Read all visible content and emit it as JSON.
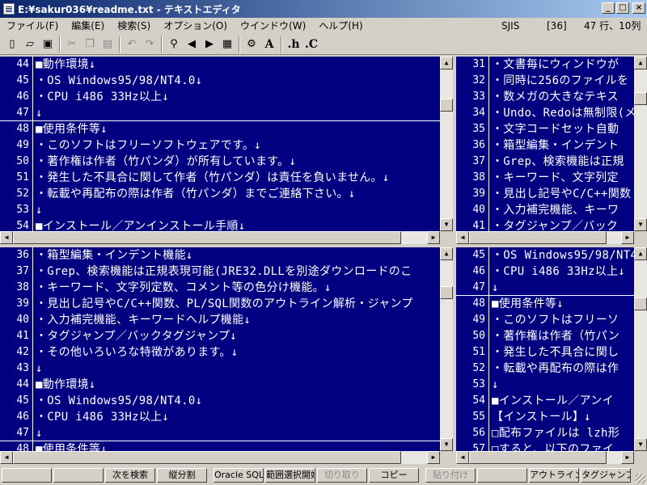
{
  "window": {
    "title": "E:¥sakur036¥readme.txt - テキストエディタ",
    "controls": [
      "_",
      "□",
      "×"
    ]
  },
  "menu": {
    "items": [
      "ファイル(F)",
      "編集(E)",
      "検索(S)",
      "オプション(O)",
      "ウインドウ(W)",
      "ヘルプ(H)"
    ],
    "encoding": "SJIS",
    "mode": "[36]",
    "position": "47 行、10列"
  },
  "toolbar": {
    "buttons": [
      {
        "icon": "new-file-icon",
        "glyph": "▯",
        "enabled": true
      },
      {
        "icon": "open-folder-icon",
        "glyph": "▱",
        "enabled": true
      },
      {
        "icon": "save-icon",
        "glyph": "▣",
        "enabled": true
      },
      {
        "icon": "cut-icon",
        "glyph": "✂",
        "enabled": false
      },
      {
        "icon": "copy-icon",
        "glyph": "❐",
        "enabled": false
      },
      {
        "icon": "paste-icon",
        "glyph": "▤",
        "enabled": false
      },
      {
        "icon": "undo-icon",
        "glyph": "↶",
        "enabled": false
      },
      {
        "icon": "redo-icon",
        "glyph": "↷",
        "enabled": false
      },
      {
        "icon": "search-icon",
        "glyph": "⚲",
        "enabled": true
      },
      {
        "icon": "find-prev-icon",
        "glyph": "◀",
        "enabled": true
      },
      {
        "icon": "find-next-icon",
        "glyph": "▶",
        "enabled": true
      },
      {
        "icon": "grep-icon",
        "glyph": "▦",
        "enabled": true
      },
      {
        "icon": "settings-icon",
        "glyph": "⚙",
        "enabled": true
      },
      {
        "icon": "font-icon",
        "glyph": "A",
        "enabled": true
      },
      {
        "icon": "h-file-icon",
        "glyph": ".h",
        "enabled": true
      },
      {
        "icon": "c-file-icon",
        "glyph": ".C",
        "enabled": true
      }
    ]
  },
  "panes": {
    "top_left": {
      "lines": [
        {
          "n": "44",
          "t": "■動作環境↓"
        },
        {
          "n": "45",
          "t": "・OS Windows95/98/NT4.0↓"
        },
        {
          "n": "46",
          "t": "・CPU i486 33Hz以上↓"
        },
        {
          "n": "47",
          "t": "↓"
        },
        {
          "n": "48",
          "t": "■使用条件等↓"
        },
        {
          "n": "49",
          "t": "・このソフトはフリーソフトウェアです。↓"
        },
        {
          "n": "50",
          "t": "・著作権は作者（竹パンダ）が所有しています。↓"
        },
        {
          "n": "51",
          "t": "・発生した不具合に関して作者（竹パンダ）は責任を負いません。↓"
        },
        {
          "n": "52",
          "t": "・転載や再配布の際は作者（竹パンダ）までご連絡下さい。↓"
        },
        {
          "n": "53",
          "t": "↓"
        },
        {
          "n": "54",
          "t": "■インストール／アンインストール手順↓"
        }
      ]
    },
    "top_right": {
      "lines": [
        {
          "n": "31",
          "t": "・文書毎にウィンドウが"
        },
        {
          "n": "32",
          "t": "・同時に256のファイルを"
        },
        {
          "n": "33",
          "t": "・数メガの大きなテキス"
        },
        {
          "n": "34",
          "t": "・Undo、Redoは無制限(メ"
        },
        {
          "n": "35",
          "t": "・文字コードセット自動"
        },
        {
          "n": "36",
          "t": "・箱型編集・インデント"
        },
        {
          "n": "37",
          "t": "・Grep、検索機能は正規"
        },
        {
          "n": "38",
          "t": "・キーワード、文字列定"
        },
        {
          "n": "39",
          "t": "・見出し記号やC/C++関数"
        },
        {
          "n": "40",
          "t": "・入力補完機能、キーワ"
        },
        {
          "n": "41",
          "t": "・タグジャンプ／バック"
        }
      ]
    },
    "bottom_left": {
      "lines": [
        {
          "n": "36",
          "t": "・箱型編集・インデント機能↓"
        },
        {
          "n": "37",
          "t": "・Grep、検索機能は正規表現可能(JRE32.DLLを別途ダウンロードのこ"
        },
        {
          "n": "38",
          "t": "・キーワード、文字列定数、コメント等の色分け機能。↓"
        },
        {
          "n": "39",
          "t": "・見出し記号やC/C++関数、PL/SQL関数のアウトライン解析・ジャンプ"
        },
        {
          "n": "40",
          "t": "・入力補完機能、キーワードヘルプ機能↓"
        },
        {
          "n": "41",
          "t": "・タグジャンプ／バックタグジャンプ↓"
        },
        {
          "n": "42",
          "t": "・その他いろいろな特徴があります。↓"
        },
        {
          "n": "43",
          "t": "↓"
        },
        {
          "n": "44",
          "t": "■動作環境↓"
        },
        {
          "n": "45",
          "t": "・OS Windows95/98/NT4.0↓"
        },
        {
          "n": "46",
          "t": "・CPU i486 33Hz以上↓"
        },
        {
          "n": "47",
          "t": "↓"
        },
        {
          "n": "48",
          "t": "■使用条件等↓"
        }
      ]
    },
    "bottom_right": {
      "lines": [
        {
          "n": "45",
          "t": "・OS Windows95/98/NT4."
        },
        {
          "n": "46",
          "t": "・CPU i486 33Hz以上↓"
        },
        {
          "n": "47",
          "t": "↓"
        },
        {
          "n": "48",
          "t": "■使用条件等↓"
        },
        {
          "n": "49",
          "t": "・このソフトはフリーソ"
        },
        {
          "n": "50",
          "t": "・著作権は作者（竹パン"
        },
        {
          "n": "51",
          "t": "・発生した不具合に関し"
        },
        {
          "n": "52",
          "t": "・転載や再配布の際は作"
        },
        {
          "n": "53",
          "t": "↓"
        },
        {
          "n": "54",
          "t": "■インストール／アンイ"
        },
        {
          "n": "55",
          "t": "【インストール】↓"
        },
        {
          "n": "56",
          "t": "□配布ファイルは lzh形"
        },
        {
          "n": "57",
          "t": "□すると、以下のファイ"
        }
      ]
    }
  },
  "function_keys": [
    {
      "label": "",
      "enabled": true
    },
    {
      "label": "",
      "enabled": true
    },
    {
      "label": "次を検索",
      "enabled": true
    },
    {
      "label": "縦分割",
      "enabled": true
    },
    {
      "label": "Oracle SQL",
      "enabled": true
    },
    {
      "label": "範囲選択開始",
      "enabled": true
    },
    {
      "label": "切り取り",
      "enabled": false
    },
    {
      "label": "コピー",
      "enabled": true
    },
    {
      "label": "貼り付け",
      "enabled": false
    },
    {
      "label": "",
      "enabled": true
    },
    {
      "label": "アウトライン解析",
      "enabled": true
    },
    {
      "label": "タグジャンプ",
      "enabled": true
    }
  ]
}
